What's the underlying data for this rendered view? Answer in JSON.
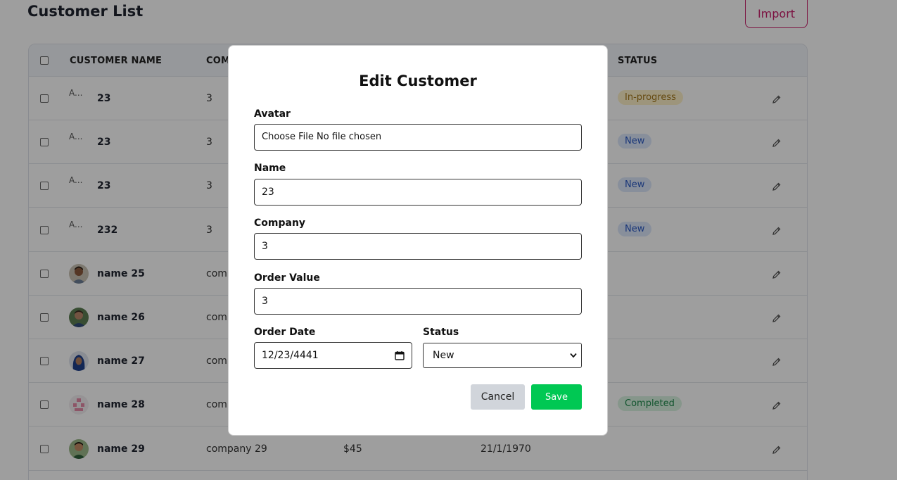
{
  "page": {
    "title": "Customer List",
    "import_label": "Import"
  },
  "table": {
    "headers": [
      "CUSTOMER NAME",
      "COMPANY",
      "STATUS"
    ],
    "rows": [
      {
        "avatar": "broken",
        "avatar_alt": "A...",
        "name": "23",
        "company": "3",
        "order_value": "",
        "order_date": "",
        "status": "In-progress"
      },
      {
        "avatar": "broken",
        "avatar_alt": "A...",
        "name": "23",
        "company": "3",
        "order_value": "",
        "order_date": "",
        "status": "New"
      },
      {
        "avatar": "broken",
        "avatar_alt": "A...",
        "name": "23",
        "company": "3",
        "order_value": "",
        "order_date": "",
        "status": "New"
      },
      {
        "avatar": "broken",
        "avatar_alt": "A...",
        "name": "232",
        "company": "3",
        "order_value": "",
        "order_date": "",
        "status": "New"
      },
      {
        "avatar": "photo-man-beard",
        "name": "name 25",
        "company": "comp",
        "order_value": "",
        "order_date": "",
        "status": ""
      },
      {
        "avatar": "photo-man-outdoor",
        "name": "name 26",
        "company": "comp",
        "order_value": "",
        "order_date": "",
        "status": ""
      },
      {
        "avatar": "photo-woman-hijab",
        "name": "name 27",
        "company": "comp",
        "order_value": "",
        "order_date": "",
        "status": ""
      },
      {
        "avatar": "pixel-identicon",
        "name": "name 28",
        "company": "comp",
        "order_value": "",
        "order_date": "",
        "status": "Completed"
      },
      {
        "avatar": "photo-man-green",
        "name": "name 29",
        "company": "company 29",
        "order_value": "$45",
        "order_date": "21/1/1970",
        "status": ""
      }
    ],
    "status_colors": {
      "In-progress": {
        "bg": "#fdf1c9",
        "fg": "#a3771a"
      },
      "New": {
        "bg": "#dce7fb",
        "fg": "#2b59c3"
      },
      "Completed": {
        "bg": "#d8f3e0",
        "fg": "#1f8a4c"
      }
    }
  },
  "modal": {
    "title": "Edit Customer",
    "avatar_label": "Avatar",
    "file_button": "Choose File",
    "file_status": "No file chosen",
    "name_label": "Name",
    "name_value": "23",
    "company_label": "Company",
    "company_value": "3",
    "order_value_label": "Order Value",
    "order_value_value": "3",
    "order_date_label": "Order Date",
    "order_date_value": "12/23/4441",
    "status_label": "Status",
    "status_value": "New",
    "cancel_label": "Cancel",
    "save_label": "Save"
  },
  "colors": {
    "accent": "#c8206b",
    "save": "#00c853",
    "cancel": "#d1d5db"
  }
}
